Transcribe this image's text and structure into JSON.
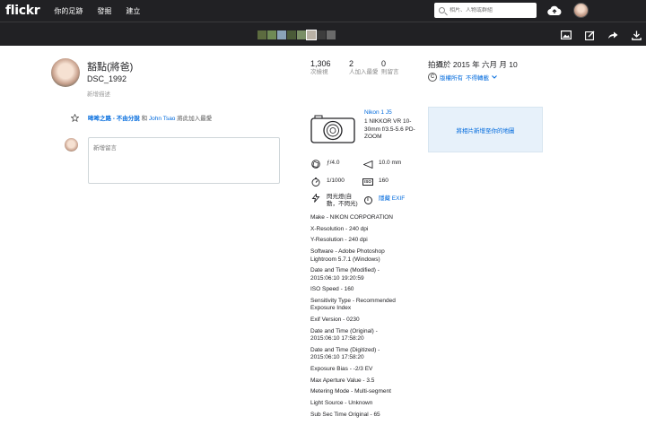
{
  "nav": {
    "logo": "flickr",
    "links": [
      "你的足跡",
      "發掘",
      "建立"
    ],
    "search_placeholder": "相片、人物或群組"
  },
  "photo": {
    "owner": "豁點(將爸)",
    "title": "DSC_1992",
    "description_placeholder": "新增描述"
  },
  "fave": {
    "album_name": "哞哞之路 - 不由分說",
    "at": "和",
    "user": "John Tsao",
    "action": "將此加入最愛"
  },
  "comment": {
    "placeholder": "新增留言"
  },
  "stats": [
    {
      "value": "1,306",
      "label": "次檢視"
    },
    {
      "value": "2",
      "label": "人加入最愛"
    },
    {
      "value": "0",
      "label": "則留言"
    }
  ],
  "taken": "拍攝於 2015 年 六月 月 10",
  "license": {
    "icon": "cc-icon",
    "text": "版權所有",
    "link": "不得轉載"
  },
  "map_text": "將相片新增至你的地圖",
  "camera": {
    "name": "Nikon 1 J5",
    "lens": "1 NIKKOR VR 10-30mm f/3.5-5.6 PD-ZOOM"
  },
  "specs": {
    "aperture": "ƒ/4.0",
    "focal_length": "10.0 mm",
    "shutter": "1/1000",
    "iso": "160",
    "flash": "閃光燈(自動，不閃光)",
    "hide_exif": "隱藏 EXIF"
  },
  "exif": [
    "Make - NIKON CORPORATION",
    "X-Resolution - 240 dpi",
    "Y-Resolution - 240 dpi",
    "Software - Adobe Photoshop Lightroom 5.7.1 (Windows)",
    "Date and Time (Modified) - 2015:06:10 19:20:59",
    "ISO Speed - 160",
    "Sensitivity Type - Recommended Exposure Index",
    "Exif Version - 0230",
    "Date and Time (Original) - 2015:06:10 17:58:20",
    "Date and Time (Digitized) - 2015:06:10 17:58:20",
    "Exposure Bias - -2/3 EV",
    "Max Aperture Value - 3.5",
    "Metering Mode - Multi-segment",
    "Light Source - Unknown",
    "Sub Sec Time Original - 65"
  ],
  "colors": {
    "nav_bg": "#212124",
    "link": "#006add",
    "map_bg": "#e7f1fa"
  }
}
